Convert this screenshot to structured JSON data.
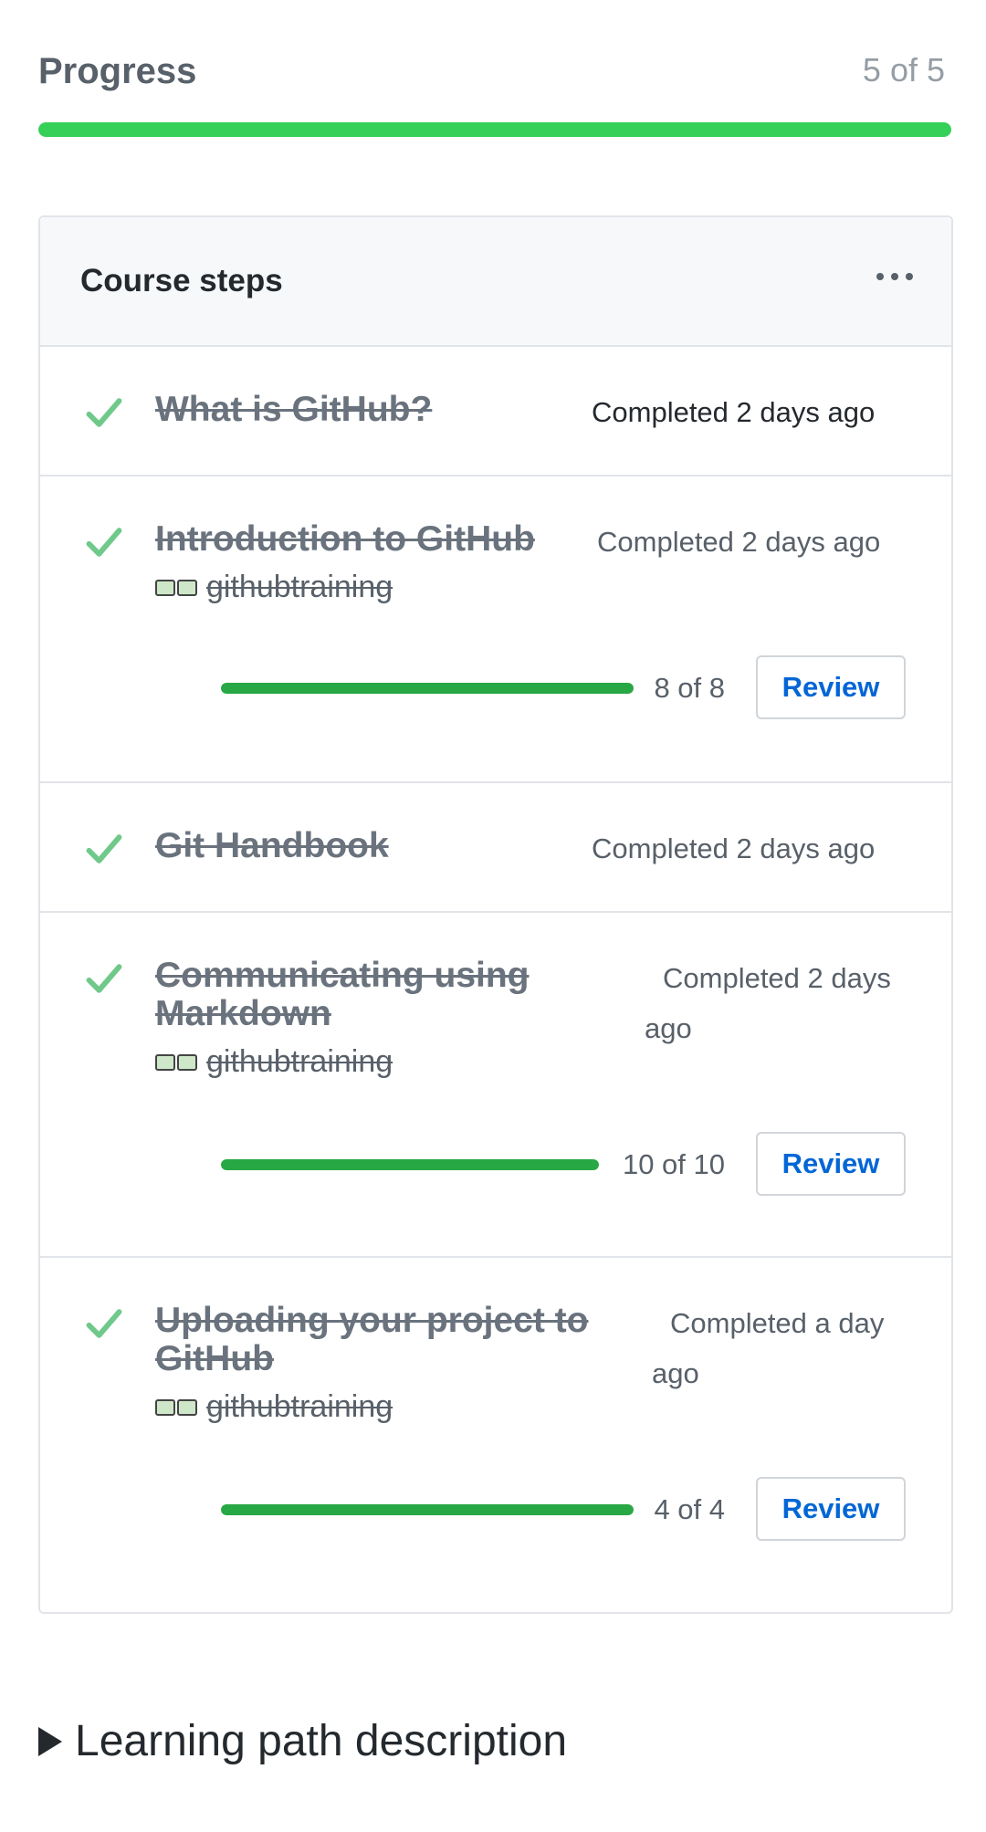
{
  "progress": {
    "title": "Progress",
    "count_text": "5 of 5",
    "completed": 5,
    "total": 5,
    "fill_fraction": 1.0,
    "bar_color": "#34d058"
  },
  "course_steps": {
    "title": "Course steps",
    "menu_icon": "more-horizontal-icon",
    "steps": [
      {
        "title": "What is GitHub?",
        "status": "Completed 2 days ago"
      },
      {
        "title": "Introduction to GitHub",
        "status": "Completed 2 days ago",
        "owner": "githubtraining",
        "progress_text": "8 of 8",
        "progress_fraction": 1.0,
        "button": "Review"
      },
      {
        "title": "Git Handbook",
        "status": "Completed 2 days ago"
      },
      {
        "title": "Communicating using Markdown",
        "status": "Completed 2 days ago",
        "owner": "githubtraining",
        "progress_text": "10 of 10",
        "progress_fraction": 1.0,
        "button": "Review"
      },
      {
        "title": "Uploading your project to GitHub",
        "status": "Completed a day ago",
        "owner": "githubtraining",
        "progress_text": "4 of 4",
        "progress_fraction": 1.0,
        "button": "Review"
      }
    ]
  },
  "learning_path": {
    "label": "Learning path description"
  },
  "colors": {
    "check": "#6fc98a",
    "step_bar": "#28a745",
    "link": "#0366d6"
  }
}
